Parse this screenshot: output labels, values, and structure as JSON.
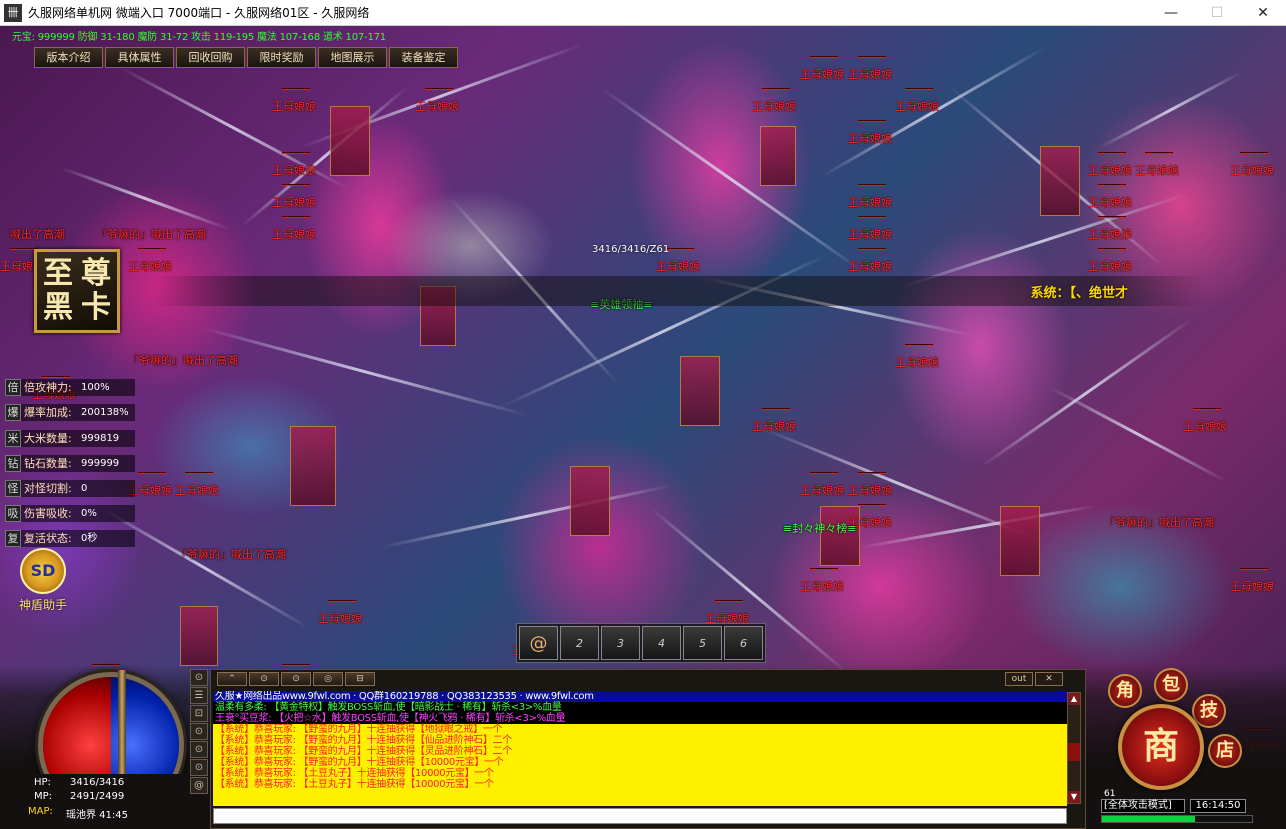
{
  "window": {
    "title": "久服网络单机网 微端入口 7000端口 - 久服网络01区 - 久服网络",
    "controls": [
      "—",
      "☐",
      "✕"
    ]
  },
  "top_stats": "元宝: 999999 防御 31-180 魔防 31-72 攻击 119-195 魔法 107-168 道术 107-171",
  "top_menu": [
    "版本介绍",
    "具体属性",
    "回收回购",
    "限时奖励",
    "地图展示",
    "装备鉴定"
  ],
  "black_card": [
    "至",
    "尊",
    "黑",
    "卡"
  ],
  "stat_rows": [
    {
      "key": "倍",
      "label": "倍攻神力:",
      "value": "100%"
    },
    {
      "key": "爆",
      "label": "爆率加成:",
      "value": "200138%"
    },
    {
      "key": "米",
      "label": "大米数量:",
      "value": "999819"
    },
    {
      "key": "钻",
      "label": "钻石数量:",
      "value": "999999"
    },
    {
      "key": "怪",
      "label": "对怪切割:",
      "value": "0"
    },
    {
      "key": "吸",
      "label": "伤害吸收:",
      "value": "0%"
    },
    {
      "key": "复",
      "label": "复活状态:",
      "value": "0秒"
    }
  ],
  "assistant": {
    "label": "神盾助手",
    "icon_text": "SD"
  },
  "monster_name": "王母娘娘",
  "shout_text": "喊出了高潮",
  "shout_player": "『爷嘛的』喊出了高潮",
  "player_hp_overhead": "3416/3416/Z61",
  "player_titles": [
    "≡英雄领袖≡",
    "≡封々神々榜≡"
  ],
  "system_banner": "系统：【、绝世才",
  "skill_slots": [
    "@",
    "2",
    "3",
    "4",
    "5",
    "6"
  ],
  "chat": {
    "tabs": [
      "⌃",
      "⊙",
      "⊙",
      "◎",
      "⊟"
    ],
    "ctl": [
      "out",
      "✕"
    ],
    "lines": [
      {
        "type": "t0",
        "text": "久服★网络出品www.9fwl.com · QQ群160219788 · QQ383123535 · www.9fwl.com"
      },
      {
        "type": "t1",
        "text": "温柔有多柔: 【黄金特权】触发BOSS斩血,使【暗影战士 · 稀有】斩杀<3>%血量"
      },
      {
        "type": "t2",
        "text": "王衰°买豆浆: 【火把☆水】触发BOSS斩血,使【神火飞鸦 · 稀有】斩杀<3>%血量"
      },
      {
        "type": "t3",
        "text": "【系统】恭喜玩家: 【野蛮的九月】十连抽获得【地狱眼之戒】一个"
      },
      {
        "type": "t3",
        "text": "【系统】恭喜玩家: 【野蛮的九月】十连抽获得【仙品进阶神石】二个"
      },
      {
        "type": "t3",
        "text": "【系统】恭喜玩家: 【野蛮的九月】十连抽获得【灵品进阶神石】二个"
      },
      {
        "type": "t3",
        "text": "【系统】恭喜玩家: 【野蛮的九月】十连抽获得【10000元宝】一个"
      },
      {
        "type": "t3",
        "text": "【系统】恭喜玩家: 【土豆丸子】十连抽获得【10000元宝】一个"
      },
      {
        "type": "t3",
        "text": "【系统】恭喜玩家: 【土豆丸子】十连抽获得【10000元宝】一个"
      }
    ]
  },
  "left_buttons": [
    "⊙",
    "☰",
    "⊡",
    "⊙",
    "⊙",
    "⊙",
    "@"
  ],
  "char_info": {
    "hp_label": "HP:",
    "hp_value": "3416/3416",
    "mp_label": "MP:",
    "mp_value": "2491/2499",
    "map_label": "MAP:",
    "map_value": "瑶池界 41:45"
  },
  "ring": {
    "center": "商",
    "small": [
      "角",
      "包",
      "技",
      "店"
    ]
  },
  "attack_mode": "[全体攻击模式]",
  "clock": "16:14:50",
  "level": "61",
  "exp_fraction": 0.62,
  "colors": {
    "monster": "#ff2a2a",
    "title": "#48ff48",
    "stats": "#2eff2e",
    "banner": "#ffd800"
  }
}
